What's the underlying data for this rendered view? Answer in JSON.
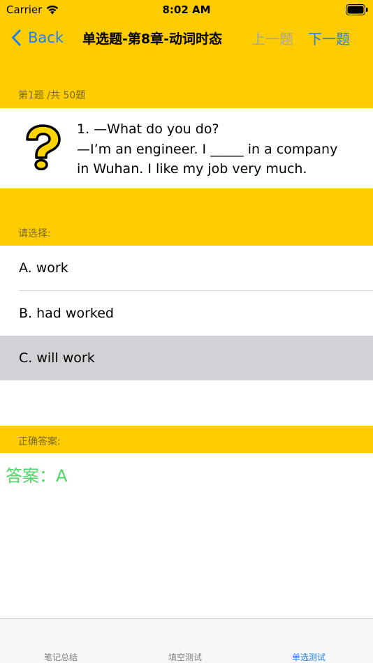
{
  "status": {
    "carrier": "Carrier",
    "time": "8:02 AM"
  },
  "nav": {
    "back_label": "Back",
    "title": "单选题-第8章-动词时态",
    "prev_label": "上一题",
    "next_label": "下一题"
  },
  "progress": {
    "label": "第1题 /共 50题"
  },
  "question": {
    "icon": "question-mark-icon",
    "lines": [
      "1. —What do you do?",
      "—I’m an engineer. I _____ in a company",
      "in Wuhan. I like my job very much."
    ]
  },
  "choose": {
    "label": "请选择:"
  },
  "options": [
    {
      "label": "A. work",
      "selected": false
    },
    {
      "label": "B. had worked",
      "selected": false
    },
    {
      "label": "C. will work",
      "selected": true
    }
  ],
  "answer": {
    "header": "正确答案:",
    "text": "答案：A",
    "color": "#4cd964"
  },
  "tabs": [
    {
      "label": "笔记总结",
      "active": false
    },
    {
      "label": "填空测试",
      "active": false
    },
    {
      "label": "单选测试",
      "active": true
    }
  ],
  "colors": {
    "background": "#ffcc00",
    "accent": "#1f7ff0",
    "disabled": "#a6a6a6",
    "selected_row": "#d1d1d6"
  }
}
